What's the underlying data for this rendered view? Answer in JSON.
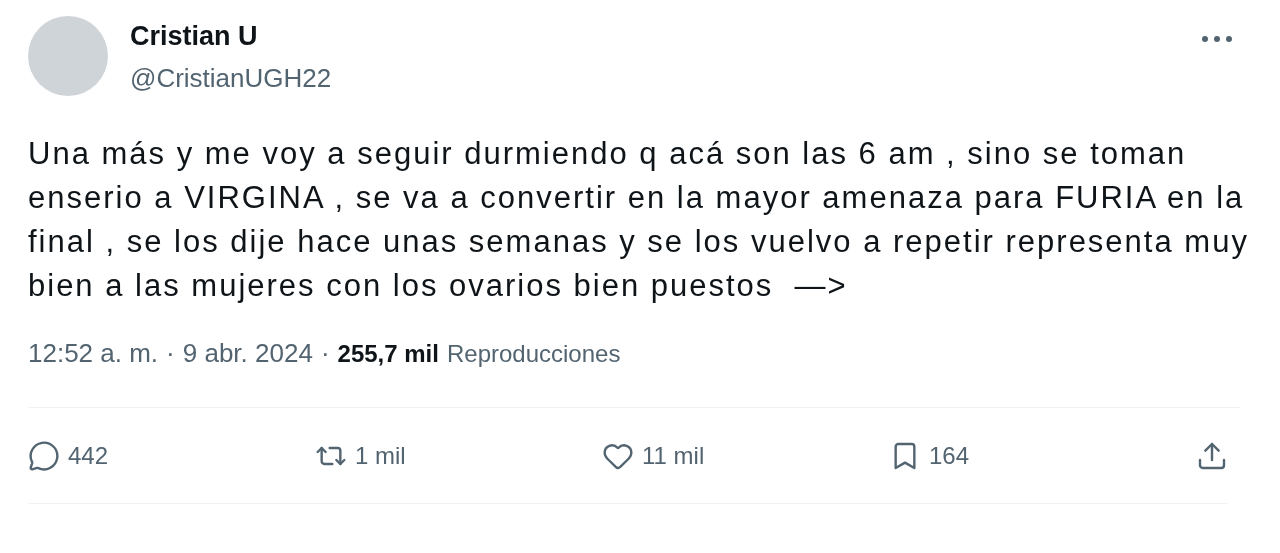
{
  "author": {
    "name": "Cristian U",
    "handle": "@CristianUGH22"
  },
  "tweet": {
    "text": "Una más y me voy a seguir durmiendo q acá son las 6 am , sino se toman enserio a VIRGINA , se va a convertir en la mayor amenaza para FURIA en la final , se los dije hace unas semanas y se los vuelvo a repetir representa muy bien a las mujeres con los ovarios bien puestos  —>"
  },
  "meta": {
    "time": "12:52 a. m.",
    "separator": "·",
    "date": "9 abr. 2024",
    "views_count": "255,7 mil",
    "views_label": "Reproducciones"
  },
  "actions": [
    {
      "kind": "reply",
      "count": "442"
    },
    {
      "kind": "repost",
      "count": "1 mil"
    },
    {
      "kind": "like",
      "count": "11 mil"
    },
    {
      "kind": "bookmark",
      "count": "164"
    },
    {
      "kind": "share"
    }
  ]
}
